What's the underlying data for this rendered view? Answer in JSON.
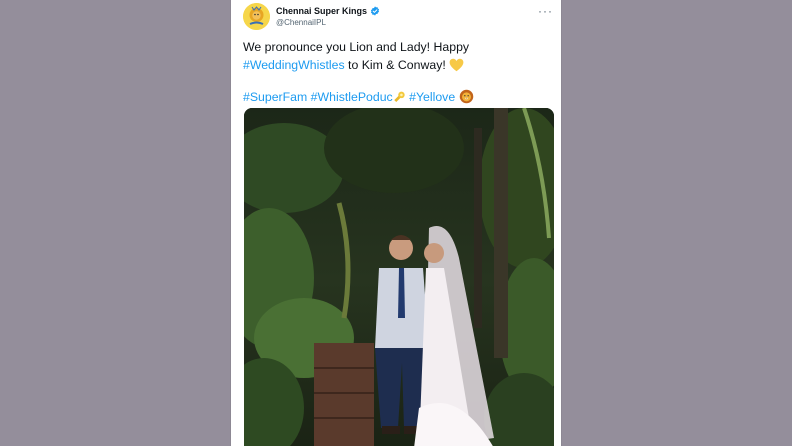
{
  "tweet": {
    "author_name": "Chennai Super Kings",
    "author_handle": "@ChennaiIPL",
    "more_label": "···",
    "line1": "We pronounce you Lion and Lady! Happy",
    "hashtag_wedding": "#WeddingWhistles",
    "line2_rest": " to Kim & Conway! ",
    "hashtag_superfam": "#SuperFam",
    "hashtag_whistle": "#WhistlePoduc",
    "hashtag_yellove": "#Yellove",
    "icons": {
      "avatar": "csk-lion-logo",
      "verified": "verified-badge-icon",
      "heart": "yellow-heart-emoji",
      "whistle": "whistle-emoji",
      "lion": "lion-emoji",
      "more": "more-options-icon"
    }
  },
  "colors": {
    "background": "#948e9b",
    "card": "#ffffff",
    "hashtag": "#1d9bf0",
    "verified": "#1d9bf0",
    "avatar": "#f6d64a",
    "heart": "#f7c947"
  }
}
